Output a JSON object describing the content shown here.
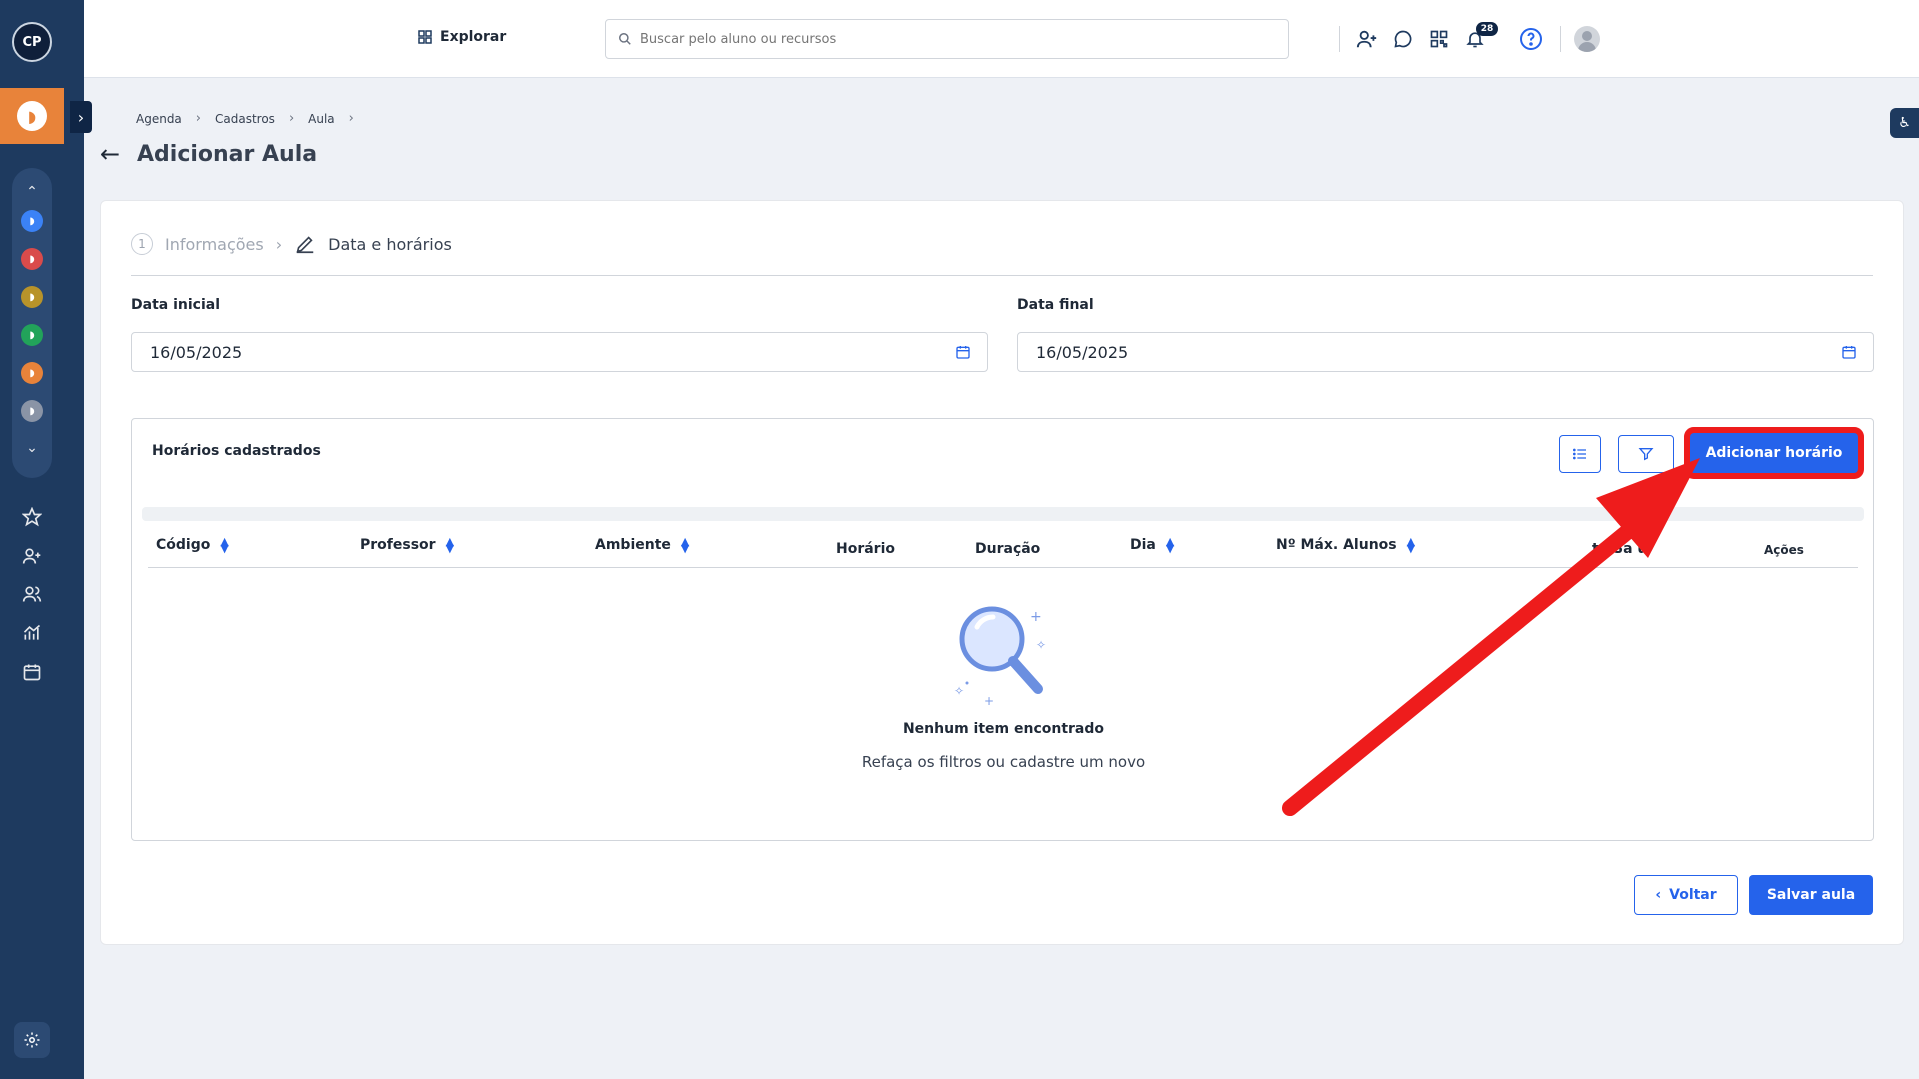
{
  "sidebar": {
    "logo": "CP",
    "module_colors": [
      "#3b82f6",
      "#d94b4b",
      "#b8932a",
      "#22a35a",
      "#e8833a",
      "#8a94a6"
    ]
  },
  "topbar": {
    "explore_label": "Explorar",
    "search_placeholder": "Buscar pelo aluno ou recursos",
    "notification_count": "28"
  },
  "breadcrumb": [
    "Agenda",
    "Cadastros",
    "Aula"
  ],
  "page": {
    "title": "Adicionar Aula"
  },
  "steps": {
    "step1_number": "1",
    "step1_label": "Informações",
    "step2_label": "Data e horários"
  },
  "form": {
    "start_date_label": "Data inicial",
    "start_date_value": "16/05/2025",
    "end_date_label": "Data final",
    "end_date_value": "16/05/2025"
  },
  "schedules": {
    "title": "Horários cadastrados",
    "add_button": "Adicionar horário",
    "columns": [
      "Código",
      "Professor",
      "Ambiente",
      "Horário",
      "Duração",
      "Dia",
      "Nº Máx. Alunos",
      "ta Sa u",
      "Ações"
    ],
    "empty_title": "Nenhum item encontrado",
    "empty_subtitle": "Refaça os filtros ou cadastre um novo"
  },
  "footer": {
    "back_label": "Voltar",
    "save_label": "Salvar aula"
  },
  "colors": {
    "primary": "#2563eb",
    "sidebar": "#1e3a5f",
    "accent": "#e8833a",
    "annotation": "#ee1c1c"
  }
}
